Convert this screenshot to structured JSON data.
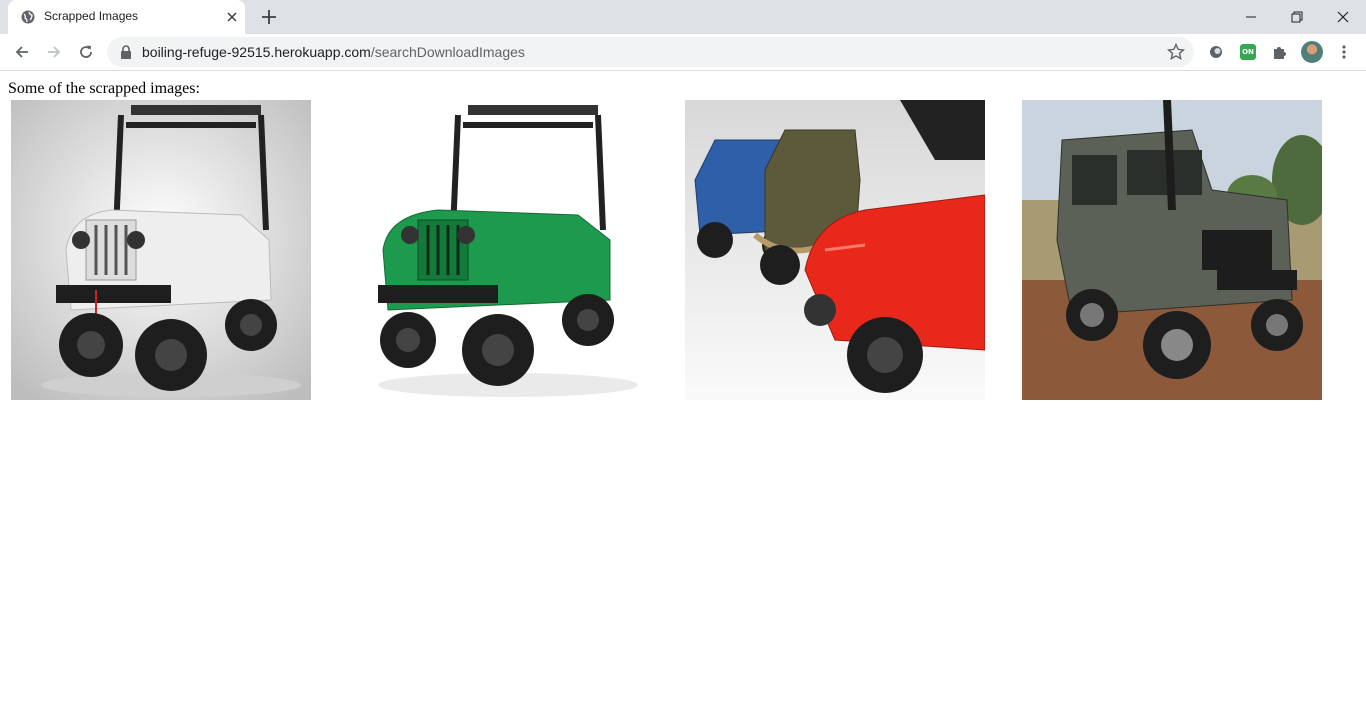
{
  "browser": {
    "tab": {
      "title": "Scrapped Images"
    },
    "address": {
      "host": "boiling-refuge-92515.herokuapp.com",
      "path": "/searchDownloadImages"
    }
  },
  "page": {
    "heading": "Some of the scrapped images:",
    "images": [
      {
        "name": "white-jeep",
        "body": "#eeeeee",
        "dark": "#2a2a2a",
        "bg": "#d9d9d9"
      },
      {
        "name": "green-jeep",
        "body": "#1e9a4e",
        "dark": "#222222",
        "bg": "#ffffff"
      },
      {
        "name": "red-jeep-group",
        "body": "#e8281b",
        "dark": "#1c1c1c",
        "bg": "#e6e6e6"
      },
      {
        "name": "grey-suv",
        "body": "#5c6157",
        "dark": "#1d1d1d",
        "bg": "#9a8d6b"
      }
    ]
  }
}
